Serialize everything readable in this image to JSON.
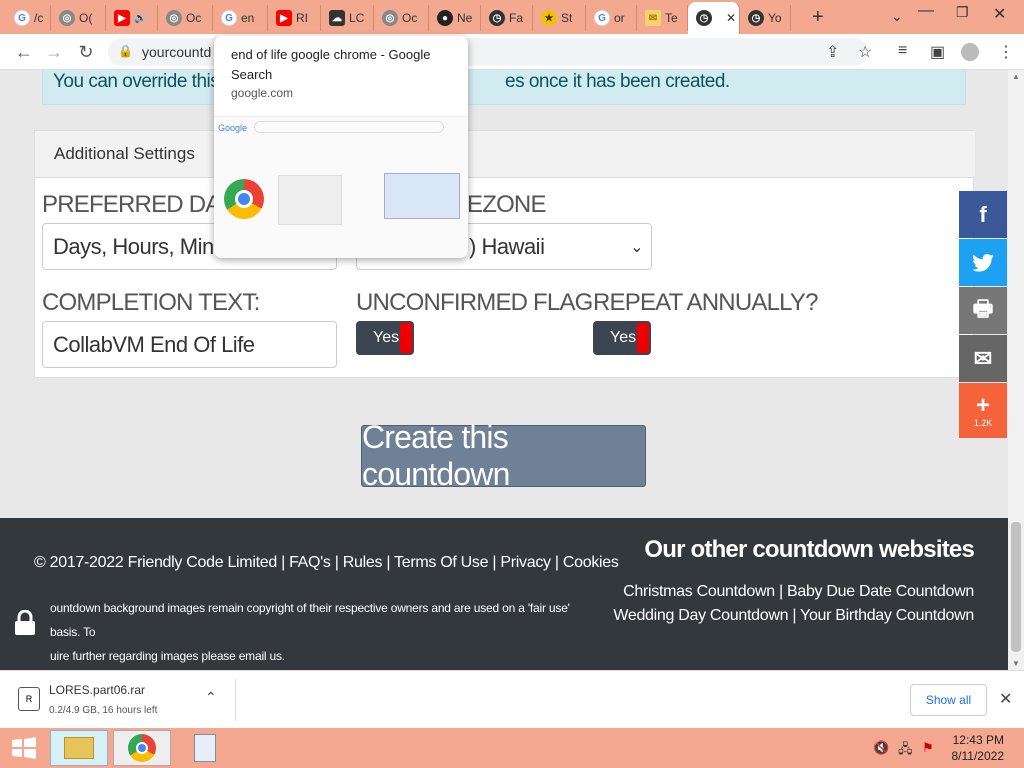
{
  "browser": {
    "tabs": [
      {
        "label": "/c",
        "icon": "google-icon"
      },
      {
        "label": "O(",
        "icon": "globe-icon"
      },
      {
        "label": "",
        "icon": "youtube-icon"
      },
      {
        "label": "Oc",
        "icon": "globe-icon"
      },
      {
        "label": "en",
        "icon": "google-icon"
      },
      {
        "label": "RI",
        "icon": "youtube-icon"
      },
      {
        "label": "LC",
        "icon": "cloud-upload-icon"
      },
      {
        "label": "Oc",
        "icon": "globe-icon"
      },
      {
        "label": "Ne",
        "icon": "github-icon"
      },
      {
        "label": "Fa",
        "icon": "countdown-icon"
      },
      {
        "label": "St",
        "icon": "star-icon"
      },
      {
        "label": "or",
        "icon": "google-icon"
      },
      {
        "label": "Te",
        "icon": "envelope-icon"
      },
      {
        "label": "",
        "icon": "countdown-icon"
      },
      {
        "label": "Yo",
        "icon": "countdown-icon"
      }
    ],
    "url": "yourcountd",
    "tab_preview": {
      "title": "end of life google chrome - Google Search",
      "domain": "google.com"
    }
  },
  "page": {
    "info_text": "You can override this co",
    "info_text_tail": "es once it has been created.",
    "settings_title": "Additional Settings",
    "preferred_label": "PREFERRED DATE FO",
    "preferred_value": "Days, Hours, Minute",
    "timezone_label": "EZONE",
    "timezone_value": ") Hawaii",
    "completion_label": "COMPLETION TEXT:",
    "completion_value": "CollabVM End Of Life",
    "unconfirmed_label": "UNCONFIRMED FLAG",
    "unconfirmed_toggle": "Yes",
    "repeat_label": "REPEAT ANNUALLY?",
    "repeat_toggle": "Yes",
    "create_button": "Create this countdown"
  },
  "footer": {
    "copyright": "© 2017-2022 Friendly Code Limited | FAQ's | Rules | Terms Of Use | Privacy | Cookies",
    "other_title": "Our other countdown websites",
    "links_line1": "Christmas Countdown | Baby Due Date Countdown",
    "links_line2": "Wedding Day Countdown | Your Birthday Countdown",
    "note_line1": "ountdown background images remain copyright of their respective owners and are used on a 'fair use' basis. To",
    "note_line2": "uire further regarding images please email us."
  },
  "share": {
    "plus_count": "1.2K",
    "colors": {
      "facebook": "#3b5998",
      "twitter": "#1da1f2",
      "print": "#777777",
      "email": "#666666",
      "more": "#f4633a"
    }
  },
  "download": {
    "filename": "LORES.part06.rar",
    "status": "0.2/4.9 GB, 16 hours left",
    "show_all": "Show all"
  },
  "taskbar": {
    "time": "12:43 PM",
    "date": "8/11/2022"
  }
}
